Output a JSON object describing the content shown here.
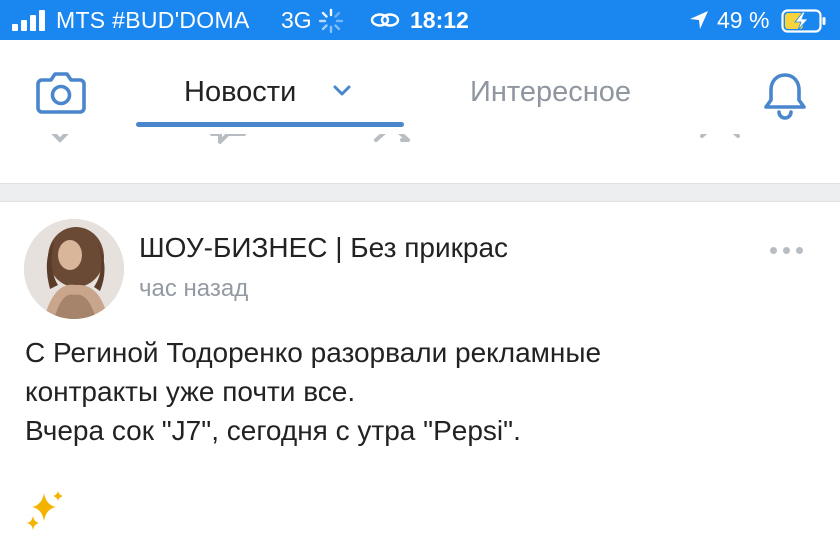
{
  "status_bar": {
    "carrier": "MTS #BUD'DOMA",
    "network": "3G",
    "time": "18:12",
    "battery_percent": "49 %",
    "bar_color": "#1a86ef"
  },
  "header": {
    "camera_icon": "camera-icon",
    "tabs": [
      {
        "label": "Новости",
        "active": true
      },
      {
        "label": "Интересное",
        "active": false
      }
    ],
    "bell_icon": "bell-icon",
    "accent_color": "#4986cc"
  },
  "previous_post_actions": {
    "icons": [
      "like-icon",
      "comment-icon",
      "share-icon",
      "views-icon"
    ]
  },
  "post": {
    "author": "ШОУ-БИЗНЕС | Без прикрас",
    "time": "час назад",
    "text_lines": [
      "С Региной Тодоренко разорвали рекламные",
      "контракты уже почти все.",
      "Вчера сок \"J7\", сегодня с утра \"Pepsi\"."
    ],
    "emoji": "✨"
  }
}
